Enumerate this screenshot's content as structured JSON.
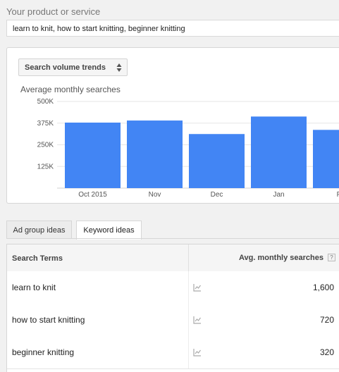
{
  "product": {
    "label": "Your product or service",
    "value": "learn to knit, how to start knitting, beginner knitting"
  },
  "chart_panel": {
    "select_label": "Search volume trends",
    "title": "Average monthly searches"
  },
  "chart_data": {
    "type": "bar",
    "title": "Average monthly searches",
    "categories": [
      "Oct 2015",
      "Nov",
      "Dec",
      "Jan",
      "Fe"
    ],
    "values": [
      378000,
      390000,
      312000,
      413000,
      336000
    ],
    "y_ticks": [
      "500K",
      "375K",
      "250K",
      "125K"
    ],
    "ylim": [
      0,
      500000
    ],
    "grid": true,
    "bar_color": "#4285f4"
  },
  "tabs": {
    "ad_group": "Ad group ideas",
    "keyword": "Keyword ideas"
  },
  "table": {
    "headers": {
      "terms": "Search Terms",
      "avg": "Avg. monthly searches",
      "help": "?"
    },
    "rows": [
      {
        "term": "learn to knit",
        "value": "1,600"
      },
      {
        "term": "how to start knitting",
        "value": "720"
      },
      {
        "term": "beginner knitting",
        "value": "320"
      }
    ]
  },
  "icons": {
    "select": "up-down-arrows-icon",
    "trend": "trend-chart-icon",
    "help": "help-icon"
  }
}
